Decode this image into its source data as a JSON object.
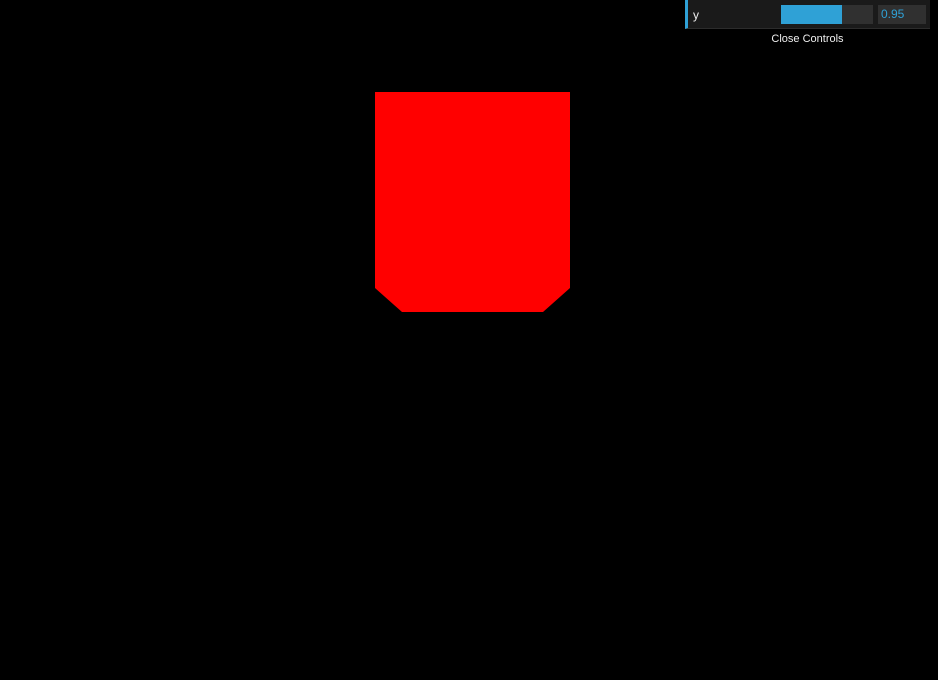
{
  "scene": {
    "background": "#000000",
    "shape_color": "#ff0000"
  },
  "controls": {
    "param_label": "y",
    "param_value": "0.95",
    "slider_fraction": 0.66,
    "accent": "#2fa1d6",
    "close_label": "Close Controls"
  }
}
